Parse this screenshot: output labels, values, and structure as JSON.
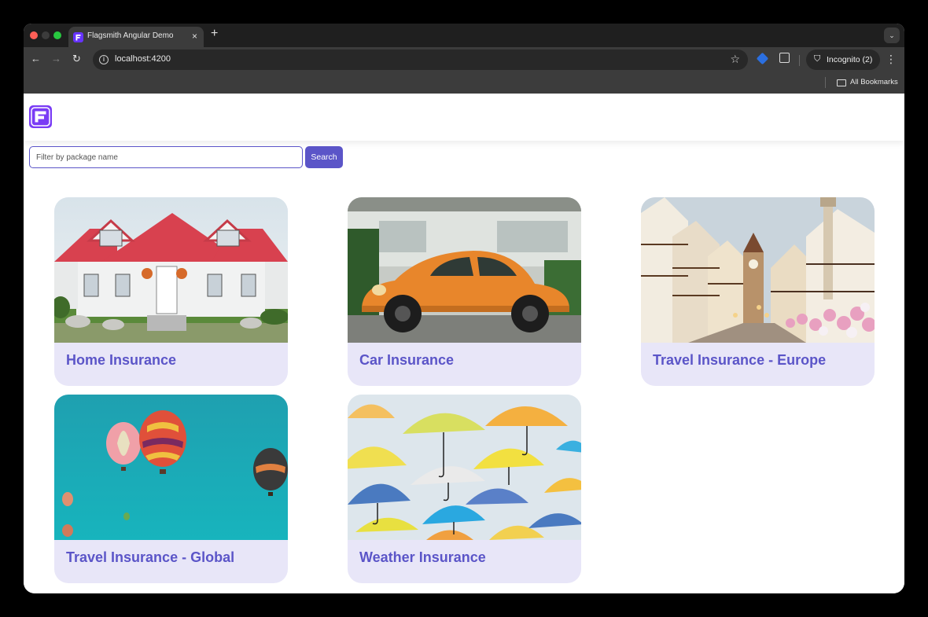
{
  "browser": {
    "tab_title": "Flagsmith Angular Demo",
    "tab_close": "×",
    "new_tab": "+",
    "url": "localhost:4200",
    "incognito_label": "Incognito (2)",
    "bookmarks_label": "All Bookmarks"
  },
  "search": {
    "placeholder": "Filter by package name",
    "button_label": "Search"
  },
  "colors": {
    "accent": "#5b55c8",
    "card_bg": "#e8e6f8",
    "logo": "#7a3cf5"
  },
  "cards": [
    {
      "title": "Home Insurance",
      "image": "house-photo"
    },
    {
      "title": "Car Insurance",
      "image": "orange-car-photo"
    },
    {
      "title": "Travel Insurance - Europe",
      "image": "old-town-street-photo"
    },
    {
      "title": "Travel Insurance - Global",
      "image": "hot-air-balloons-photo"
    },
    {
      "title": "Weather Insurance",
      "image": "umbrellas-photo"
    }
  ]
}
